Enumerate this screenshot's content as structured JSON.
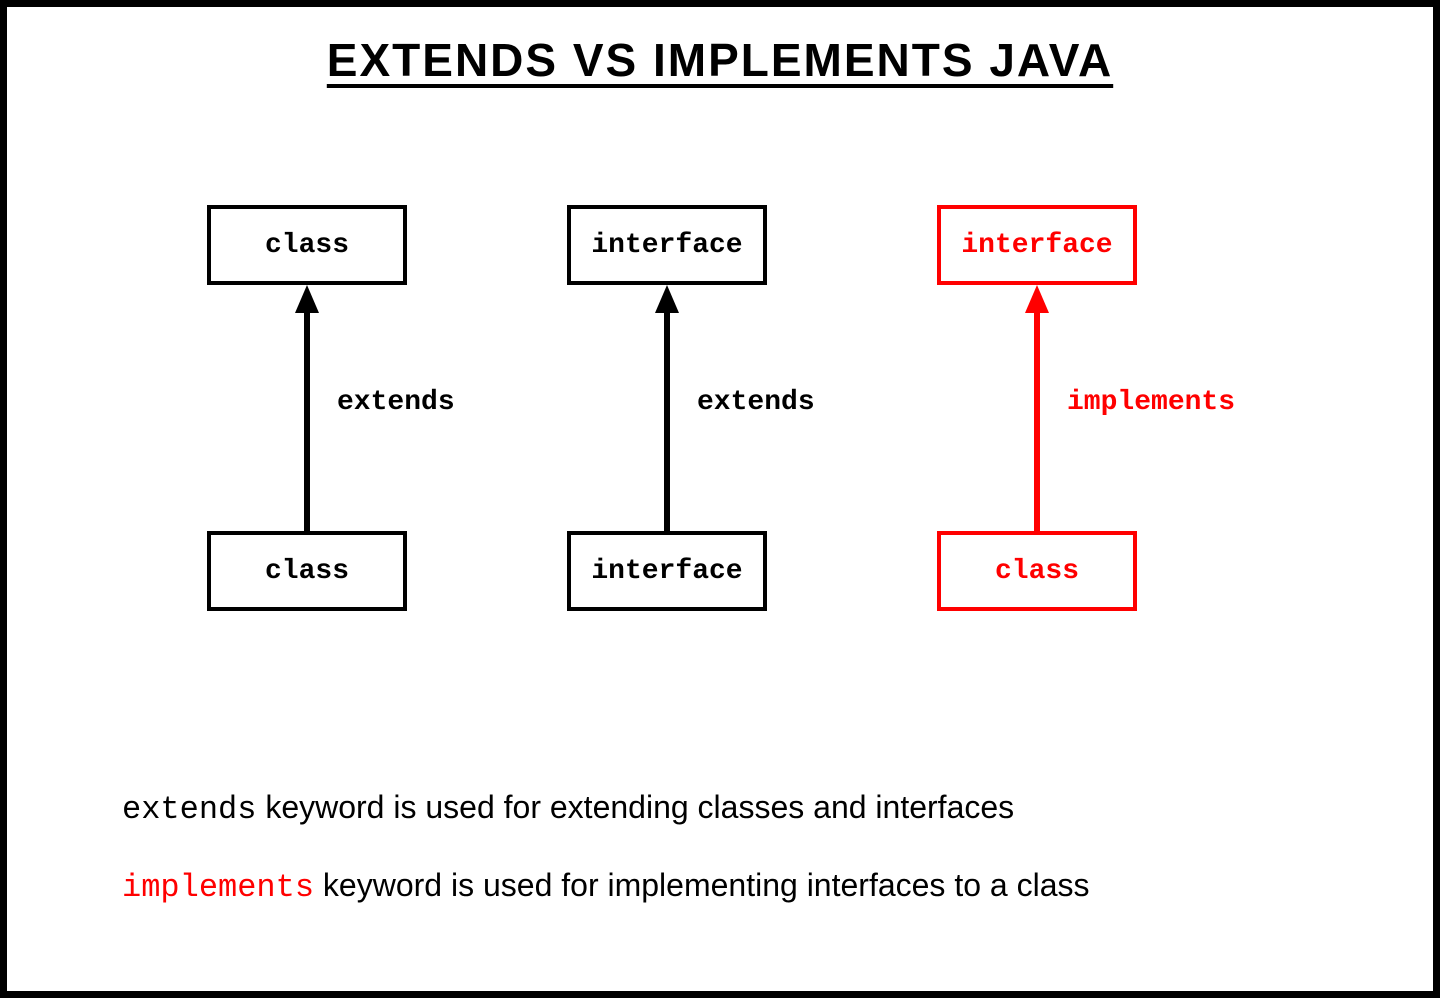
{
  "title": "EXTENDS VS IMPLEMENTS JAVA",
  "columns": [
    {
      "top": "class",
      "bottom": "class",
      "relation": "extends",
      "color": "black"
    },
    {
      "top": "interface",
      "bottom": "interface",
      "relation": "extends",
      "color": "black"
    },
    {
      "top": "interface",
      "bottom": "class",
      "relation": "implements",
      "color": "red"
    }
  ],
  "descriptions": [
    {
      "keyword": "extends",
      "rest": " keyword is used for extending classes and interfaces",
      "keywordColor": "black"
    },
    {
      "keyword": "implements",
      "rest": " keyword is used for implementing interfaces to a class",
      "keywordColor": "red"
    }
  ],
  "colors": {
    "black": "#000000",
    "red": "#ff0000"
  }
}
